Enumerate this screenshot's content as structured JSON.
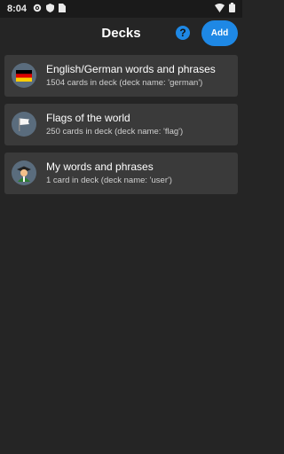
{
  "status_bar": {
    "time": "8:04",
    "icons": [
      "gear-icon",
      "shield-icon",
      "sim-card-icon",
      "wifi-icon",
      "battery-icon"
    ]
  },
  "header": {
    "title": "Decks",
    "help_label": "?",
    "add_label": "Add"
  },
  "colors": {
    "background": "#252525",
    "card": "#3a3a3a",
    "accent": "#1e88e5"
  },
  "decks": [
    {
      "title": "English/German words and phrases",
      "subtitle": "1504 cards in deck (deck name: 'german')",
      "icon": "german-flag-icon"
    },
    {
      "title": "Flags of the world",
      "subtitle": "250 cards in deck (deck name: 'flag')",
      "icon": "white-flag-icon"
    },
    {
      "title": "My words and phrases",
      "subtitle": "1 card in deck (deck name: 'user')",
      "icon": "student-icon"
    }
  ]
}
